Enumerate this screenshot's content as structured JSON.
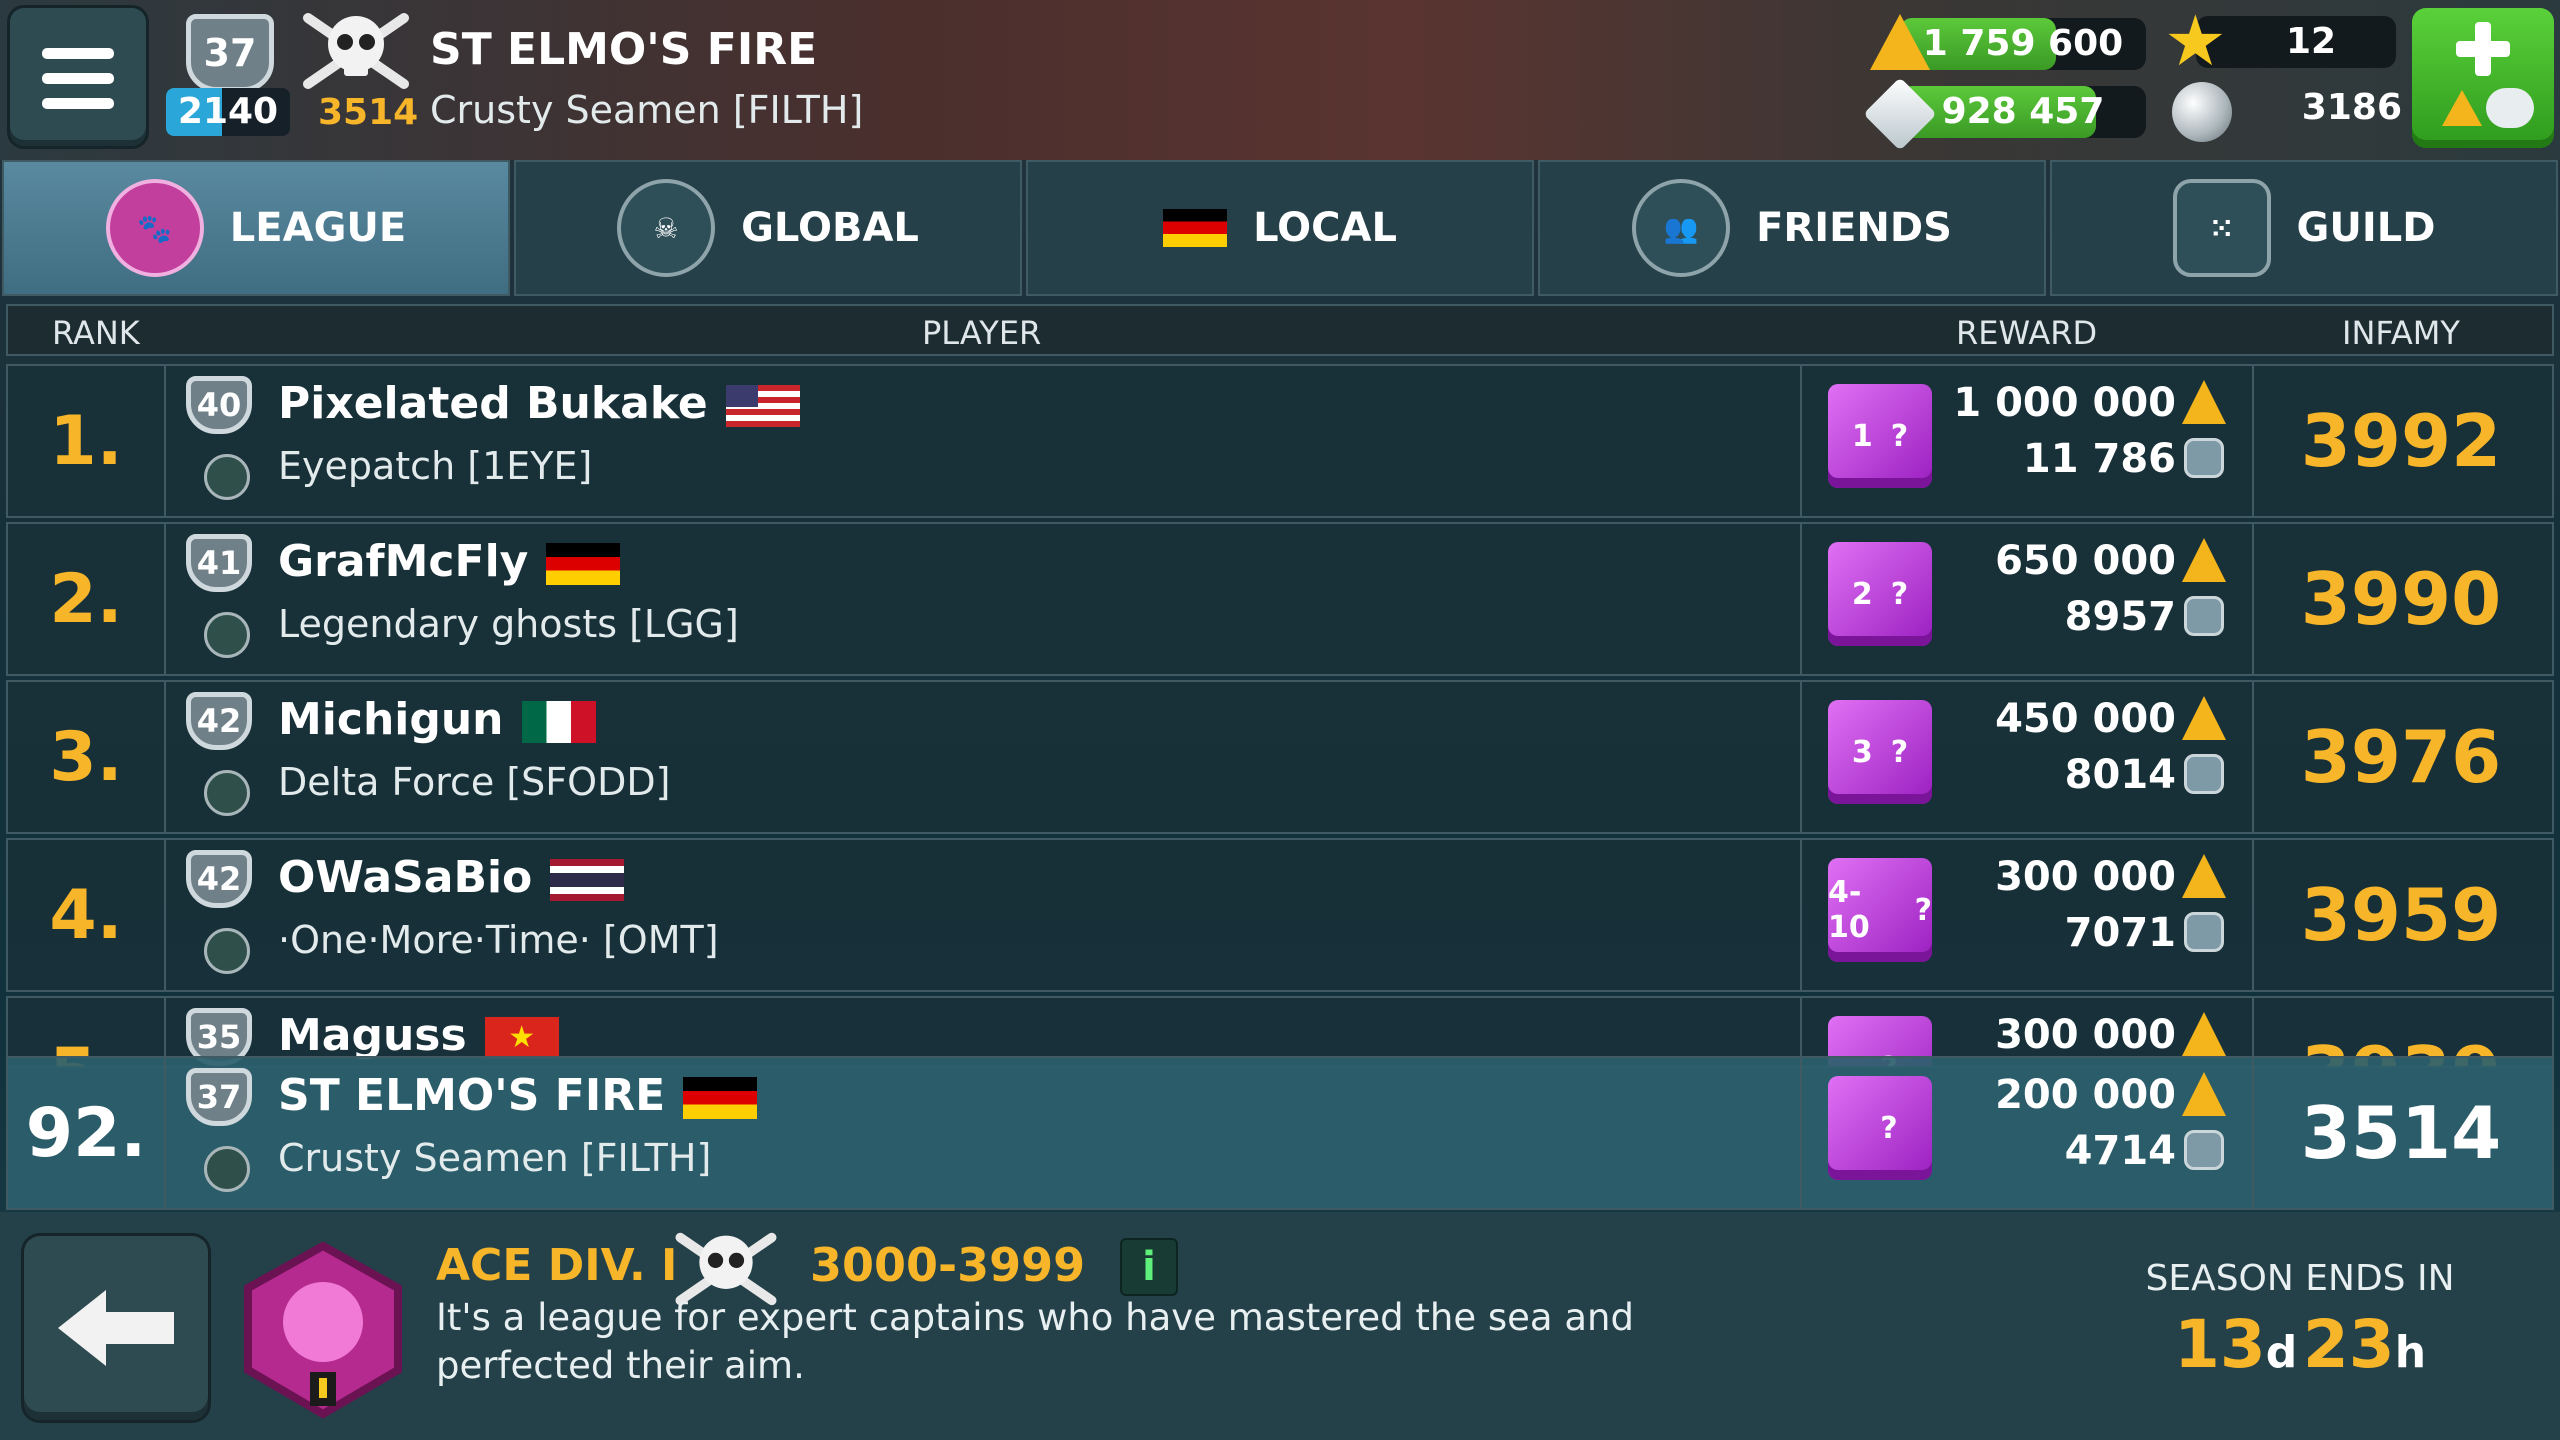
{
  "top": {
    "level": "37",
    "xp": "2140",
    "xp_fraction": 0.45,
    "infamy": "3514",
    "player_name": "ST ELMO'S FIRE",
    "guild_name": "Crusty Seamen [FILTH]",
    "gold": "1 759 600",
    "silver": "928 457",
    "stars": "12",
    "pearls": "3186"
  },
  "tabs": [
    {
      "label": "LEAGUE",
      "icon": "paw-badge-icon",
      "active": true
    },
    {
      "label": "GLOBAL",
      "icon": "skull-badge-icon",
      "active": false
    },
    {
      "label": "LOCAL",
      "icon": "germany-flag-icon",
      "active": false
    },
    {
      "label": "FRIENDS",
      "icon": "friends-badge-icon",
      "active": false
    },
    {
      "label": "GUILD",
      "icon": "guild-badge-icon",
      "active": false
    }
  ],
  "columns": {
    "rank": "RANK",
    "player": "PLAYER",
    "reward": "REWARD",
    "infamy": "INFAMY"
  },
  "rows": [
    {
      "rank": "1.",
      "level": "40",
      "name": "Pixelated Bukake",
      "flag": "usa",
      "guild": "Eyepatch [1EYE]",
      "chest": "1",
      "gold": "1 000 000",
      "silver": "11 786",
      "infamy": "3992"
    },
    {
      "rank": "2.",
      "level": "41",
      "name": "GrafMcFly",
      "flag": "germany",
      "guild": "Legendary ghosts [LGG]",
      "chest": "2",
      "gold": "650 000",
      "silver": "8957",
      "infamy": "3990"
    },
    {
      "rank": "3.",
      "level": "42",
      "name": "Michigun",
      "flag": "mexico",
      "guild": "Delta Force [SFODD]",
      "chest": "3",
      "gold": "450 000",
      "silver": "8014",
      "infamy": "3976"
    },
    {
      "rank": "4.",
      "level": "42",
      "name": "OWaSaBio",
      "flag": "thailand",
      "guild": "·One·More·Time· [OMT]",
      "chest": "4-10",
      "gold": "300 000",
      "silver": "7071",
      "infamy": "3959"
    },
    {
      "rank": "5.",
      "level": "35",
      "name": "Maguss",
      "flag": "vietnam",
      "guild": "",
      "chest": "",
      "gold": "300 000",
      "silver": "",
      "infamy": "3939"
    }
  ],
  "me": {
    "rank": "92.",
    "level": "37",
    "name": "ST ELMO'S FIRE",
    "flag": "germany",
    "guild": "Crusty Seamen [FILTH]",
    "chest": "",
    "gold": "200 000",
    "silver": "4714",
    "infamy": "3514"
  },
  "footer": {
    "division": "ACE DIV. I",
    "range": "3000-3999",
    "info": "i",
    "description_line1": "It's a league for expert captains who have mastered the sea and",
    "description_line2": "perfected their aim.",
    "season_label": "SEASON ENDS IN",
    "days": "13",
    "days_unit": "d",
    "hours": "23",
    "hours_unit": "h"
  },
  "colors": {
    "accent_gold": "#f7b529",
    "tab_active": "#4f7f95",
    "panel": "#193038",
    "green": "#44b42b"
  }
}
